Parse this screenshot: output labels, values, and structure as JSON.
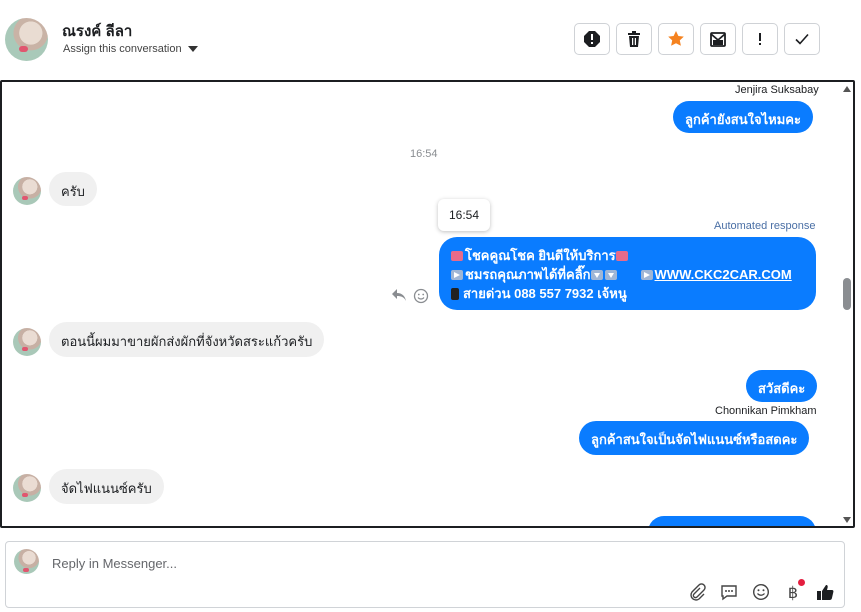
{
  "header": {
    "contact_name": "ณรงค์ ลีลา",
    "assign_label": "Assign this conversation",
    "toolbar": [
      "spam-icon",
      "trash-icon",
      "star-icon",
      "mark-unread-icon",
      "exclamation-icon",
      "check-icon"
    ]
  },
  "colors": {
    "accent": "#0a7cff",
    "star": "#f5821f",
    "incoming_bg": "#f0f0f0"
  },
  "thread": {
    "messages": [
      {
        "direction": "outgoing",
        "sender": "Jenjira Suksabay",
        "text": "ลูกค้ายังสนใจไหมคะ"
      },
      {
        "type": "timestamp",
        "text": "16:54"
      },
      {
        "direction": "incoming",
        "text": "ครับ"
      },
      {
        "type": "tooltip",
        "text": "16:54"
      },
      {
        "direction": "outgoing",
        "label": "Automated response",
        "lines": [
          "โชคคูณโชค ยินดีให้บริการ",
          "ชมรถคุณภาพได้ที่คลิ๊ก",
          "WWW.CKC2CAR.COM",
          "สายด่วน 088 557 7932 เจ้หนู"
        ]
      },
      {
        "direction": "incoming",
        "text": "ตอนนี้ผมมาขายผักส่งผักที่จังหวัดสระแก้วครับ"
      },
      {
        "direction": "outgoing",
        "text": "สวัสดีคะ"
      },
      {
        "direction": "outgoing",
        "sender": "Chonnikan Pimkham",
        "text": "ลูกค้าสนใจเป็นจัดไฟแนนซ์หรือสดคะ"
      },
      {
        "direction": "incoming",
        "text": "จัดไฟแนนซ์ครับ"
      }
    ]
  },
  "composer": {
    "placeholder": "Reply in Messenger...",
    "tools": [
      "attachment-icon",
      "saved-replies-icon",
      "emoji-icon",
      "baht-icon",
      "like-icon"
    ],
    "baht_symbol": "฿"
  }
}
